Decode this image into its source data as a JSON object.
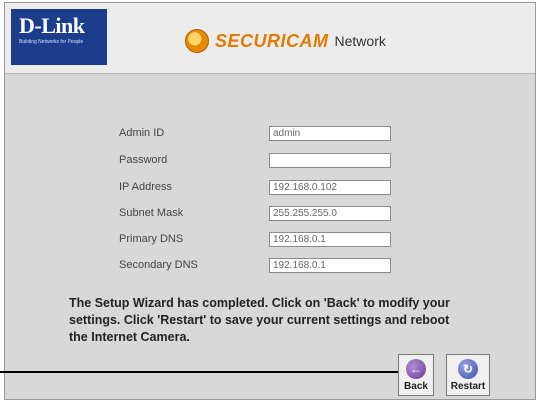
{
  "header": {
    "brand_logo": "D-Link",
    "brand_tagline": "Building Networks for People",
    "product_name": "SECURICAM",
    "product_suffix": "Network"
  },
  "form": {
    "rows": [
      {
        "label": "Admin ID",
        "value": "admin"
      },
      {
        "label": "Password",
        "value": ""
      },
      {
        "label": "IP Address",
        "value": "192.168.0.102"
      },
      {
        "label": "Subnet Mask",
        "value": "255.255.255.0"
      },
      {
        "label": "Primary DNS",
        "value": "192.168.0.1"
      },
      {
        "label": "Secondary DNS",
        "value": "192.168.0.1"
      }
    ]
  },
  "message": "The Setup Wizard has completed. Click on 'Back' to modify your settings. Click 'Restart' to save your current settings and reboot the Internet Camera.",
  "buttons": {
    "back_label": "Back",
    "restart_label": "Restart"
  },
  "colors": {
    "brand": "#1c3c8c",
    "product": "#e07a00"
  }
}
